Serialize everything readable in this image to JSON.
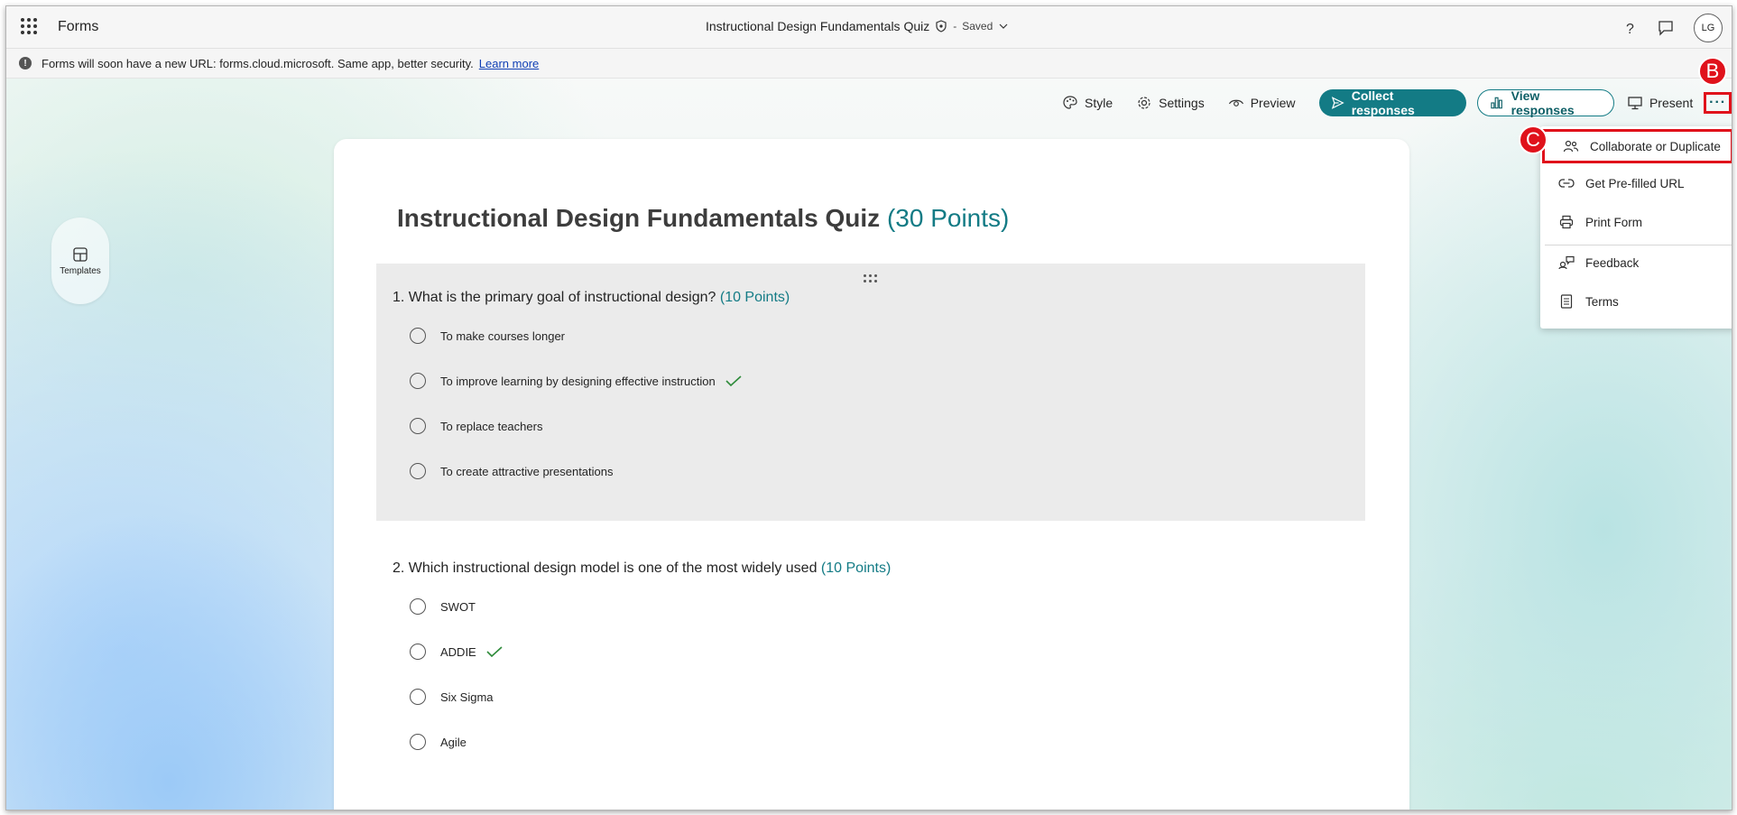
{
  "app": {
    "name": "Forms"
  },
  "document": {
    "title": "Instructional Design Fundamentals Quiz",
    "separator": "-",
    "status": "Saved"
  },
  "user": {
    "initials": "LG"
  },
  "banner": {
    "text": "Forms will soon have a new URL: forms.cloud.microsoft. Same app, better security.",
    "link": "Learn more"
  },
  "toolbar": {
    "style": "Style",
    "settings": "Settings",
    "preview": "Preview",
    "collect": "Collect responses",
    "view": "View responses",
    "present": "Present",
    "more": "···"
  },
  "annotations": {
    "b": "B",
    "c": "C"
  },
  "sidebar": {
    "templates": "Templates"
  },
  "form": {
    "title": "Instructional Design Fundamentals Quiz",
    "points": "(30 Points)",
    "questions": [
      {
        "text": "1. What is the primary goal of instructional design?",
        "points": "(10 Points)",
        "options": [
          "To make courses longer",
          "To improve learning by designing effective instruction",
          "To replace teachers",
          "To create attractive presentations"
        ],
        "correct_index": 1
      },
      {
        "text": "2. Which instructional design model is one of the most widely used",
        "points": "(10 Points)",
        "options": [
          "SWOT",
          "ADDIE",
          "Six Sigma",
          "Agile"
        ],
        "correct_index": 1
      }
    ]
  },
  "menu": {
    "items": [
      {
        "label": "Collaborate or Duplicate",
        "icon": "people-icon"
      },
      {
        "label": "Get Pre-filled URL",
        "icon": "link-icon"
      },
      {
        "label": "Print Form",
        "icon": "printer-icon"
      },
      {
        "label": "Feedback",
        "icon": "feedback-icon"
      },
      {
        "label": "Terms",
        "icon": "document-icon"
      }
    ]
  },
  "colors": {
    "accent": "#137b85",
    "annotation": "#e0121b",
    "check": "#2e8b3a"
  }
}
